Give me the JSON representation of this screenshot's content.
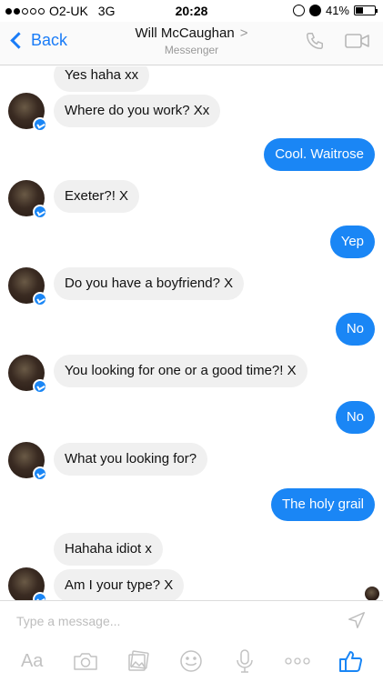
{
  "status_bar": {
    "carrier": "O2-UK",
    "network": "3G",
    "time": "20:28",
    "battery_percent": "41%",
    "battery_level": 0.41,
    "signal_bars_filled": 2,
    "signal_bars_total": 5
  },
  "nav": {
    "back_label": "Back",
    "contact_name": "Will McCaughan",
    "title_arrow": ">",
    "subtitle": "Messenger",
    "icons": [
      "phone-icon",
      "video-camera-icon"
    ]
  },
  "messages": [
    {
      "direction": "in",
      "text": "Yes haha xx"
    },
    {
      "direction": "in",
      "text": "Where do you work? Xx"
    },
    {
      "direction": "out",
      "text": "Cool. Waitrose"
    },
    {
      "direction": "in",
      "text": "Exeter?! X"
    },
    {
      "direction": "out",
      "text": "Yep"
    },
    {
      "direction": "in",
      "text": "Do you have a boyfriend? X"
    },
    {
      "direction": "out",
      "text": "No"
    },
    {
      "direction": "in",
      "text": "You looking for one or a good time?! X"
    },
    {
      "direction": "out",
      "text": "No"
    },
    {
      "direction": "in",
      "text": "What you looking for?"
    },
    {
      "direction": "out",
      "text": "The holy grail"
    },
    {
      "direction": "in",
      "text": "Hahaha idiot x"
    },
    {
      "direction": "in",
      "text": "Am I your type? X"
    }
  ],
  "composer": {
    "placeholder": "Type a message...",
    "toolbar_text": "Aa",
    "toolbar_icons": [
      "text-format-icon",
      "camera-icon",
      "photo-gallery-icon",
      "emoji-icon",
      "microphone-icon",
      "more-icon",
      "like-thumb-icon"
    ],
    "colors": {
      "accent": "#1a86f5",
      "muted": "#c2c2c2"
    }
  }
}
